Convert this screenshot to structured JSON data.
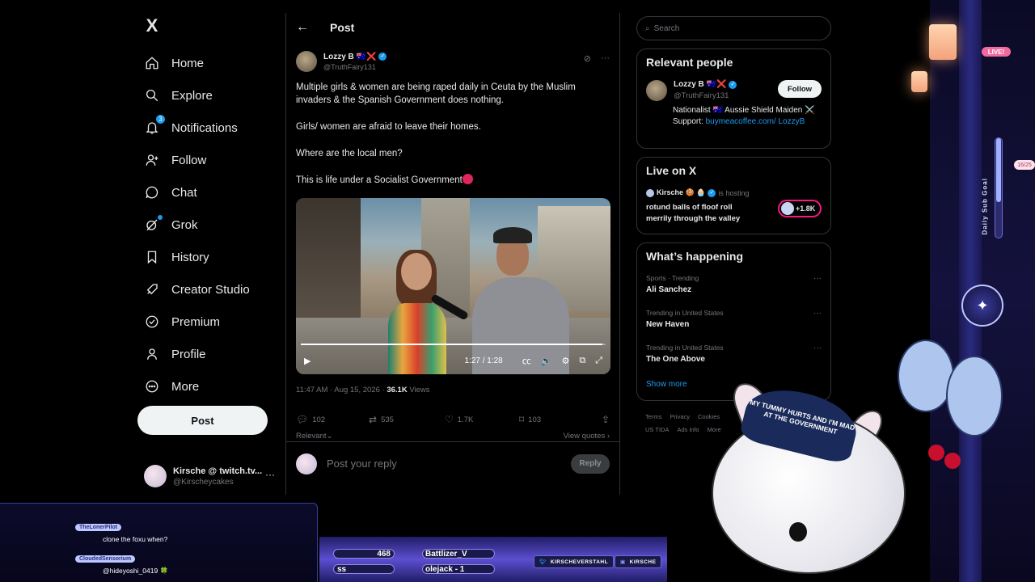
{
  "nav": {
    "logo": "X",
    "items": [
      {
        "label": "Home",
        "icon": "home-icon"
      },
      {
        "label": "Explore",
        "icon": "search-icon"
      },
      {
        "label": "Notifications",
        "icon": "bell-icon",
        "badge": "3"
      },
      {
        "label": "Follow",
        "icon": "person-plus-icon"
      },
      {
        "label": "Chat",
        "icon": "chat-icon"
      },
      {
        "label": "Grok",
        "icon": "grok-icon"
      },
      {
        "label": "History",
        "icon": "bookmark-icon"
      },
      {
        "label": "Creator Studio",
        "icon": "rocket-icon"
      },
      {
        "label": "Premium",
        "icon": "verified-icon"
      },
      {
        "label": "Profile",
        "icon": "person-icon"
      },
      {
        "label": "More",
        "icon": "more-circle-icon"
      }
    ],
    "post_button": "Post",
    "account": {
      "name": "Kirsche @ twitch.tv...",
      "handle": "@Kirscheycakes",
      "more": "···"
    }
  },
  "post": {
    "header_title": "Post",
    "author": {
      "name": "Lozzy B 🇦🇺❌",
      "handle": "@TruthFairy131"
    },
    "paragraphs": [
      "Multiple girls & women are being raped daily in Ceuta by the Muslim invaders & the Spanish Government does nothing.",
      "Girls/ women are afraid to leave their homes.",
      "Where are the local men?",
      "This is life under a Socialist Government"
    ],
    "video": {
      "time": "1:27 / 1:28",
      "progress": 0.99
    },
    "timestamp": "11:47 AM · Aug 15, 2026 · ",
    "views_count": "36.1K",
    "views_label": " Views",
    "stats": {
      "replies": "102",
      "reposts": "535",
      "likes": "1.7K",
      "bookmarks": "103"
    },
    "sort_label": "Relevant",
    "view_quotes": "View quotes ›",
    "reply_placeholder": "Post your reply",
    "reply_button": "Reply"
  },
  "sidebar": {
    "search_placeholder": "Search",
    "relevant": {
      "title": "Relevant people",
      "name": "Lozzy B 🇦🇺❌",
      "handle": "@TruthFairy131",
      "follow": "Follow",
      "bio_text": "Nationalist 🇦🇺 Aussie Shield Maiden ⚔️ Support: ",
      "bio_link": "buymeacoffee.com/ LozzyB"
    },
    "live": {
      "title": "Live on X",
      "host": "Kirsche 🍪 🧁",
      "hosting": "is hosting",
      "stream_title": "rotund balls of floof roll merrily through the valley",
      "listeners": "+1.8K"
    },
    "happening": {
      "title": "What’s happening",
      "trends": [
        {
          "category": "Sports · Trending",
          "name": "Ali Sanchez"
        },
        {
          "category": "Trending in United States",
          "name": "New Haven"
        },
        {
          "category": "Trending in United States",
          "name": "The One Above"
        }
      ],
      "show_more": "Show more"
    },
    "footer": [
      "Terms",
      "Privacy",
      "Cookies",
      "US TIDA",
      "Ads info",
      "More"
    ]
  },
  "overlay": {
    "live_badge": "LIVE!",
    "subgoal_label": "Daily Sub Goal",
    "subgoal_count": "16/25",
    "subgoal_progress": 0.64,
    "bottom_stats": [
      "468",
      "ss",
      "Battlizer_V",
      "olejack - 1"
    ],
    "socials": [
      "KIRSCHEVERSTAHL",
      "KIRSCHE"
    ],
    "cap_text": "MY TUMMY HURTS AND I'M MAD AT THE GOVERNMENT",
    "chat": [
      {
        "user": "TheLonerPilot",
        "message": "clone the foxu when?"
      },
      {
        "user": "CloudedSensorium",
        "message": "@hideyoshi_0419 🍀"
      }
    ]
  },
  "colors": {
    "accent": "#1d9bf0",
    "bg": "#000000",
    "border": "#2f3336",
    "muted": "#71767b",
    "live": "#f91880"
  }
}
